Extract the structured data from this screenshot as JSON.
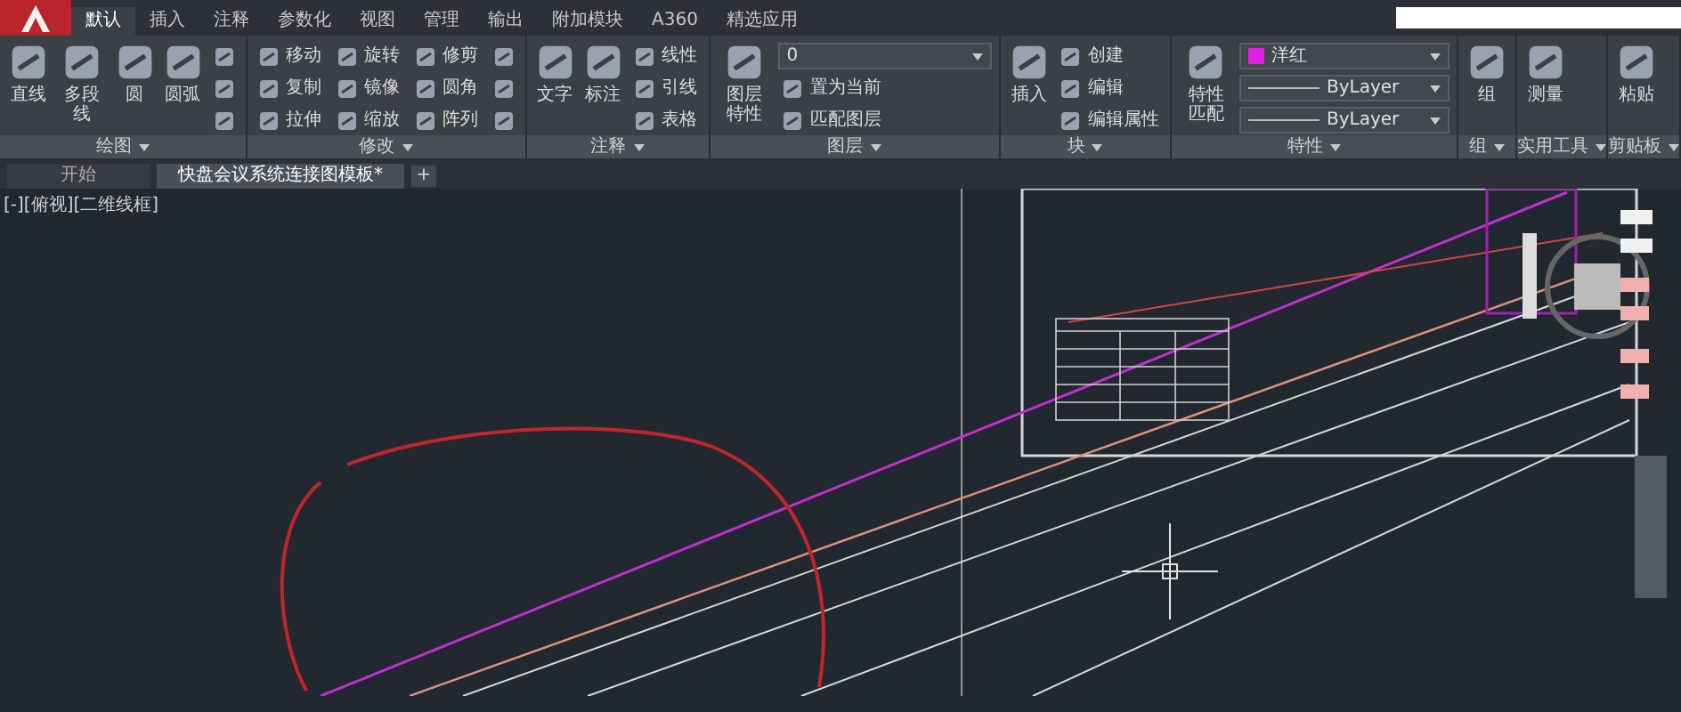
{
  "ribbon_tabs": [
    {
      "label": "默认",
      "selected": true
    },
    {
      "label": "插入",
      "selected": false
    },
    {
      "label": "注释",
      "selected": false
    },
    {
      "label": "参数化",
      "selected": false
    },
    {
      "label": "视图",
      "selected": false
    },
    {
      "label": "管理",
      "selected": false
    },
    {
      "label": "输出",
      "selected": false
    },
    {
      "label": "附加模块",
      "selected": false
    },
    {
      "label": "A360",
      "selected": false
    },
    {
      "label": "精选应用",
      "selected": false
    }
  ],
  "panels": [
    {
      "title": "绘图",
      "tools": [
        {
          "kind": "large",
          "label": "直线"
        },
        {
          "kind": "large",
          "label": "多段线"
        },
        {
          "kind": "large",
          "label": "圆"
        },
        {
          "kind": "large",
          "label": "圆弧"
        },
        {
          "kind": "icon"
        },
        {
          "kind": "icon"
        },
        {
          "kind": "icon"
        }
      ]
    },
    {
      "title": "修改",
      "tools": [
        {
          "kind": "small",
          "label": "移动"
        },
        {
          "kind": "small",
          "label": "复制"
        },
        {
          "kind": "small",
          "label": "拉伸"
        },
        {
          "kind": "small",
          "label": "旋转"
        },
        {
          "kind": "small",
          "label": "镜像"
        },
        {
          "kind": "small",
          "label": "缩放"
        },
        {
          "kind": "small",
          "label": "修剪"
        },
        {
          "kind": "small",
          "label": "圆角"
        },
        {
          "kind": "small",
          "label": "阵列"
        },
        {
          "kind": "icon"
        },
        {
          "kind": "icon"
        },
        {
          "kind": "icon"
        }
      ]
    },
    {
      "title": "注释",
      "tools": [
        {
          "kind": "large",
          "label": "文字"
        },
        {
          "kind": "large",
          "label": "标注"
        },
        {
          "kind": "small",
          "label": "线性"
        },
        {
          "kind": "small",
          "label": "引线"
        },
        {
          "kind": "small",
          "label": "表格"
        }
      ]
    },
    {
      "title": "图层",
      "tools": [
        {
          "kind": "large",
          "label": "图层特性"
        },
        {
          "kind": "dropdown",
          "label": "0"
        },
        {
          "kind": "small",
          "label": "置为当前"
        },
        {
          "kind": "small",
          "label": "匹配图层"
        }
      ]
    },
    {
      "title": "块",
      "tools": [
        {
          "kind": "large",
          "label": "插入"
        },
        {
          "kind": "small",
          "label": "创建"
        },
        {
          "kind": "small",
          "label": "编辑"
        },
        {
          "kind": "small",
          "label": "编辑属性"
        }
      ]
    },
    {
      "title": "特性",
      "tools": [
        {
          "kind": "large",
          "label": "特性匹配"
        },
        {
          "kind": "dropdown",
          "label": "洋红",
          "color": "#e020e0"
        },
        {
          "kind": "dropdown",
          "label": "ByLayer"
        },
        {
          "kind": "dropdown",
          "label": "ByLayer"
        }
      ]
    },
    {
      "title": "组",
      "tools": [
        {
          "kind": "large",
          "label": "组"
        }
      ]
    },
    {
      "title": "实用工具",
      "tools": [
        {
          "kind": "large",
          "label": "测量"
        }
      ]
    },
    {
      "title": "剪贴板",
      "tools": [
        {
          "kind": "large",
          "label": "粘贴"
        }
      ]
    }
  ],
  "document_tabs": [
    {
      "label": "开始",
      "selected": false
    },
    {
      "label": "快盘会议系统连接图模板*",
      "selected": true
    }
  ],
  "new_tab": "+",
  "viewport_label": "[-][俯视][二维线框]"
}
